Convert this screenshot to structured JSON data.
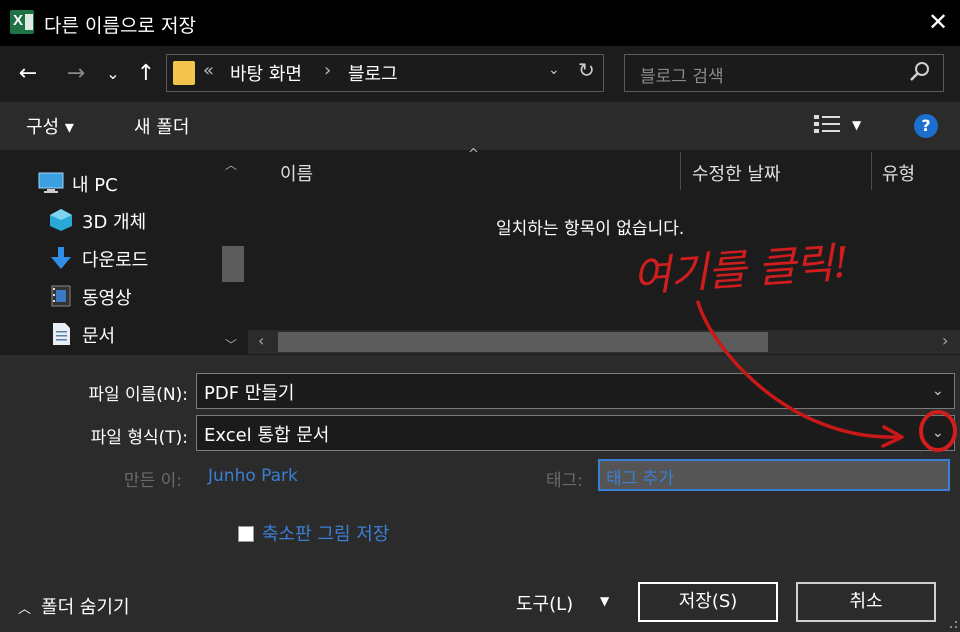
{
  "window": {
    "title": "다른 이름으로 저장",
    "app_icon": "excel-icon",
    "close_glyph": "✕"
  },
  "nav": {
    "back": "←",
    "forward": "→",
    "recent": "⌄",
    "up": "↑",
    "breadcrumb_prefix": "«",
    "crumbs": [
      "바탕 화면",
      "블로그"
    ],
    "crumb_sep": "›",
    "dropdown": "⌄",
    "refresh": "↻",
    "search_placeholder": "블로그 검색"
  },
  "toolbar": {
    "organize": "구성 ▾",
    "new_folder": "새 폴더",
    "help": "?"
  },
  "sidebar": {
    "items": [
      {
        "label": "내 PC",
        "icon": "pc-icon"
      },
      {
        "label": "3D 개체",
        "icon": "3d-objects-icon"
      },
      {
        "label": "다운로드",
        "icon": "download-icon"
      },
      {
        "label": "동영상",
        "icon": "video-icon"
      },
      {
        "label": "문서",
        "icon": "document-icon"
      }
    ]
  },
  "filelist": {
    "columns": [
      "이름",
      "수정한 날짜",
      "유형"
    ],
    "empty_message": "일치하는 항목이 없습니다."
  },
  "form": {
    "filename_label": "파일 이름(N):",
    "filename_value": "PDF 만들기",
    "filetype_label": "파일 형식(T):",
    "filetype_value": "Excel 통합 문서",
    "author_label": "만든 이:",
    "author_value": "Junho Park",
    "tags_label": "태그:",
    "tags_placeholder": "태그 추가",
    "thumbnail_label": "축소판 그림 저장"
  },
  "footer": {
    "hide_folders": "폴더 숨기기",
    "tools": "도구(L)",
    "save": "저장(S)",
    "cancel": "취소"
  },
  "annotation": {
    "text": "여기를 클릭!",
    "color": "#d01d1d"
  },
  "colors": {
    "accent": "#3b7fd4",
    "titlebar": "#000000",
    "panel": "#1c1c1c",
    "background": "#2b2b2b"
  }
}
